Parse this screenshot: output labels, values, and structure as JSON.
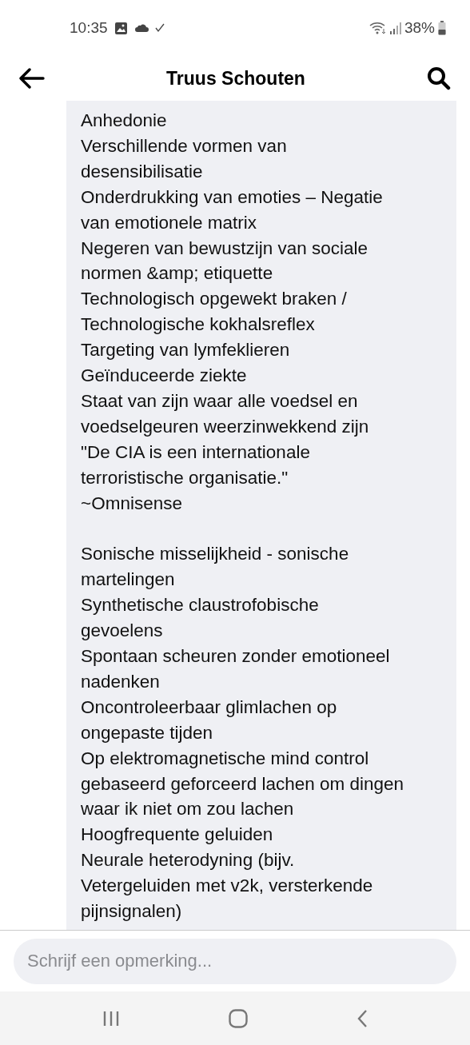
{
  "status_bar": {
    "time": "10:35",
    "battery": "38%"
  },
  "header": {
    "title": "Truus Schouten"
  },
  "comment": {
    "blocks": [
      {
        "lines": [
          "Anhedonie",
          "Verschillende vormen van",
          "desensibilisatie",
          "Onderdrukking van emoties – Negatie",
          "van emotionele matrix",
          "Negeren van bewustzijn van sociale",
          "normen &amp; etiquette",
          "Technologisch opgewekt braken /",
          "Technologische kokhalsreflex",
          "Targeting van lymfeklieren",
          "Geïnduceerde ziekte",
          "Staat van zijn waar alle voedsel en",
          "voedselgeuren weerzinwekkend zijn",
          "\"De CIA is een internationale",
          "terroristische organisatie.\"",
          "~Omnisense"
        ]
      },
      {
        "lines": [
          "Sonische misselijkheid - sonische",
          "martelingen",
          "Synthetische claustrofobische",
          "gevoelens",
          "Spontaan scheuren zonder emotioneel",
          "nadenken",
          "Oncontroleerbaar glimlachen op",
          "ongepaste tijden",
          "Op elektromagnetische mind control",
          "gebaseerd geforceerd lachen om dingen",
          "waar ik niet om zou lachen",
          "Hoogfrequente geluiden",
          "Neurale heterodyning (bijv.",
          "Vetergeluiden met v2k, versterkende",
          "pijnsignalen)"
        ]
      }
    ]
  },
  "composer": {
    "placeholder": "Schrijf een opmerking..."
  }
}
